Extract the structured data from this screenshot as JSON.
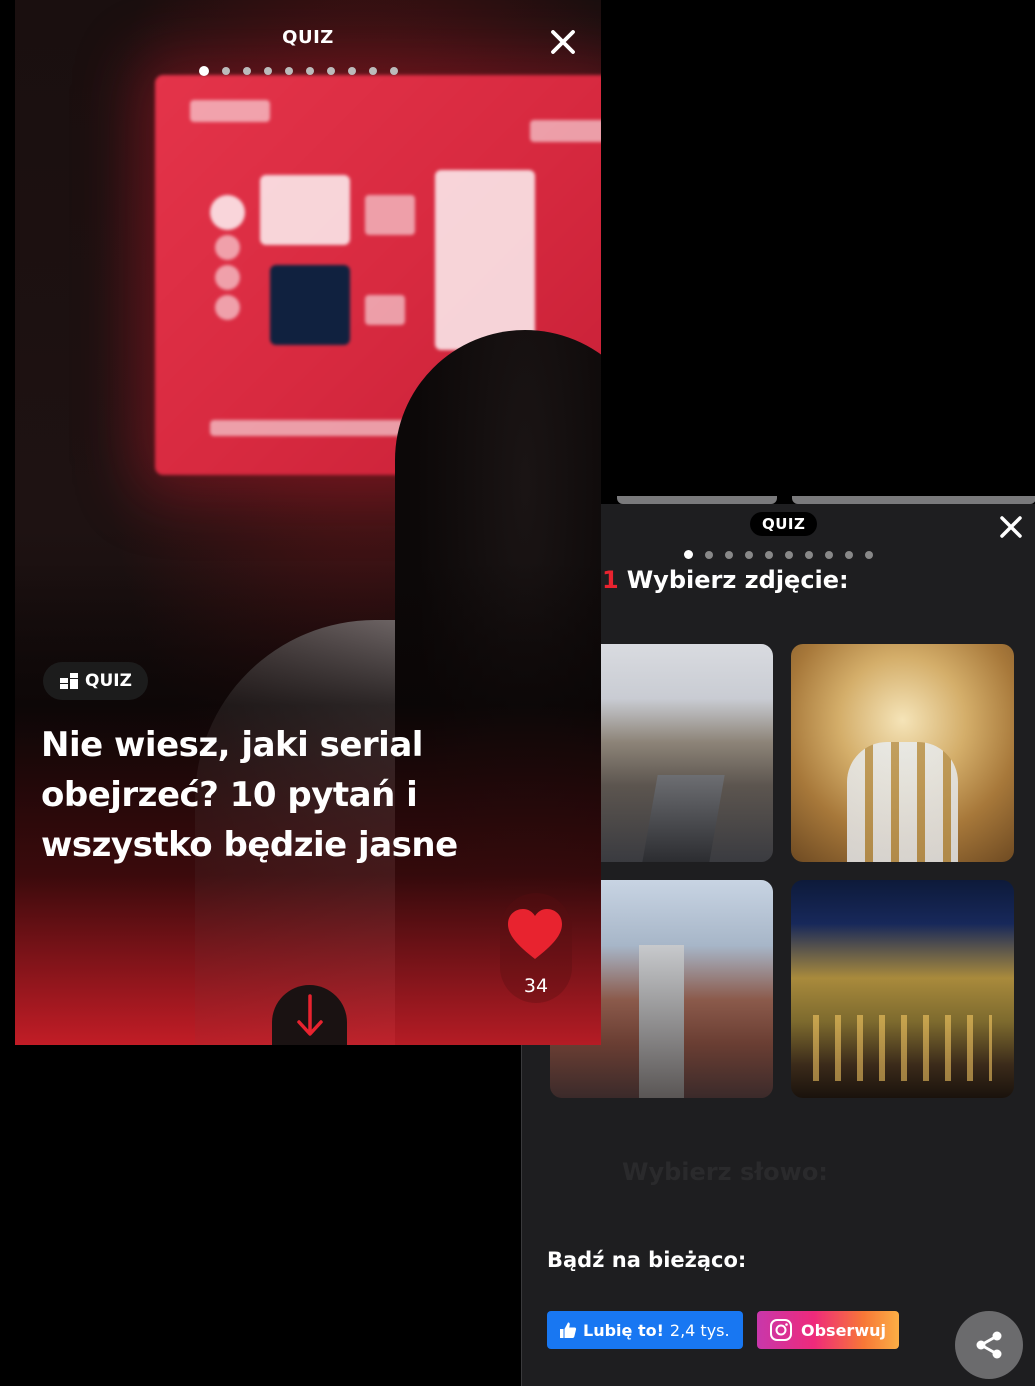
{
  "front_card": {
    "header_label": "QUIZ",
    "progress": {
      "total": 10,
      "current": 1
    },
    "badge_label": "QUIZ",
    "title": "Nie wiesz, jaki serial obejrzeć? 10 pytań i wszystko będzie jasne",
    "likes_count": "34",
    "colors": {
      "accent": "#e8232f"
    }
  },
  "back_card": {
    "header_label": "QUIZ",
    "progress": {
      "total": 10,
      "current": 1
    },
    "question_number": "1",
    "question_text": "Wybierz zdjęcie:",
    "photos": [
      {
        "label": ""
      },
      {
        "label": ""
      },
      {
        "label": ""
      },
      {
        "label": ""
      }
    ],
    "next_question_text": "Wybierz słowo:",
    "follow_title": "Bądź na bieżąco:",
    "fb_like_label": "Lubię to!",
    "fb_like_count": "2,4 tys.",
    "instagram_label": "Obserwuj",
    "colors": {
      "facebook": "#1877f2",
      "instagram_start": "#c837ab",
      "instagram_end": "#fcaf45"
    }
  }
}
